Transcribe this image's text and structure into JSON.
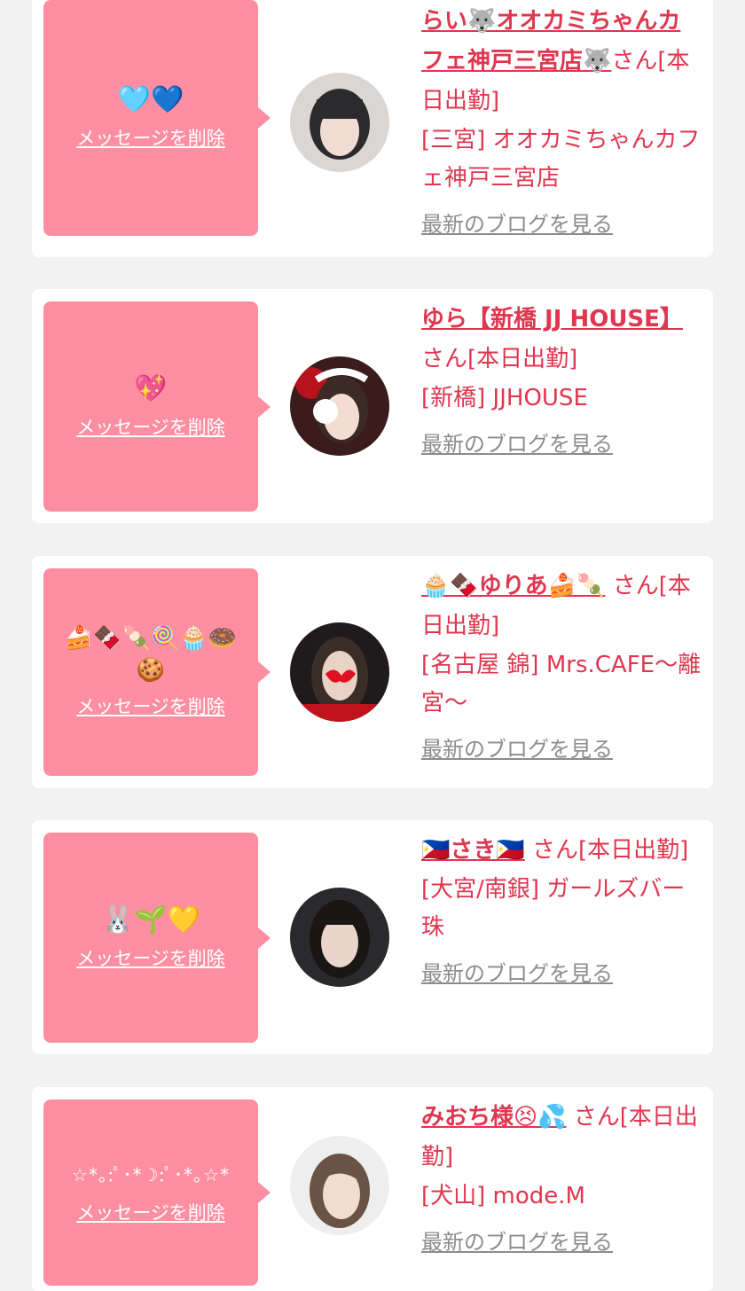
{
  "delete_label": "メッセージを削除",
  "blog_label": "最新のブログを見る",
  "colors": {
    "bubble": "#fe8fa2",
    "accent": "#e0364f",
    "link_gray": "#8c8c8c",
    "page_bg": "#f2f2f2"
  },
  "cards": [
    {
      "message": "🩵💙",
      "name": "らい🐺オオカミちゃんカフェ神戸三宮店🐺",
      "suffix": "さん[本日出勤]",
      "shop": "[三宮] オオカミちゃんカフェ神戸三宮店"
    },
    {
      "message": "💖",
      "name": "ゆら【新橋 JJ HOUSE】",
      "suffix": "さん[本日出勤]",
      "shop": "[新橋] JJHOUSE"
    },
    {
      "message": "🍰🍫🍡🍭🧁🍩🍪",
      "name": "🧁🍫ゆりあ🍰🍡",
      "suffix": "さん[本日出勤]",
      "shop": "[名古屋 錦] Mrs.CAFE〜離宮〜"
    },
    {
      "message": "🐰🌱💛",
      "name": "🇵🇭さき🇵🇭",
      "suffix": "さん[本日出勤]",
      "shop": "[大宮/南銀] ガールズバー 珠"
    },
    {
      "message": "☆*｡:ﾟ･*☽:ﾟ･*｡☆*",
      "name": "みおち様😣💦",
      "suffix": "さん[本日出勤]",
      "shop": "[犬山] mode.M"
    }
  ]
}
